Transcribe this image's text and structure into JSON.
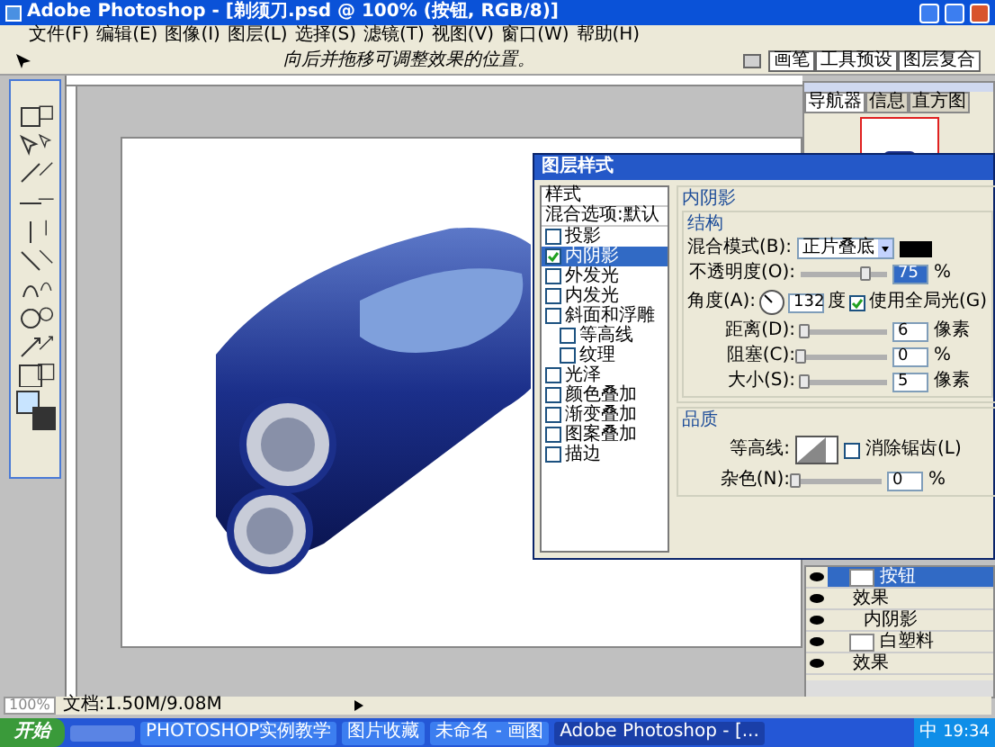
{
  "window": {
    "title": "Adobe Photoshop - [剃须刀.psd @ 100% (按钮, RGB/8)]"
  },
  "menu": [
    "文件(F)",
    "编辑(E)",
    "图像(I)",
    "图层(L)",
    "选择(S)",
    "滤镜(T)",
    "视图(V)",
    "窗口(W)",
    "帮助(H)"
  ],
  "options_bar": {
    "hint": "向后并拖移可调整效果的位置。",
    "palette_tabs": [
      "画笔",
      "工具预设",
      "图层复合"
    ]
  },
  "navigator": {
    "tabs": [
      {
        "label": "导航器",
        "selected": true
      },
      {
        "label": "信息",
        "selected": false
      },
      {
        "label": "直方图",
        "selected": false
      }
    ]
  },
  "layer_style_dialog": {
    "title": "图层样式",
    "styles": [
      {
        "kind": "header",
        "label": "样式",
        "selected": false
      },
      {
        "kind": "header",
        "label": "混合选项:默认",
        "selected": false
      },
      {
        "kind": "check",
        "label": "投影",
        "checked": false,
        "selected": false
      },
      {
        "kind": "check",
        "label": "内阴影",
        "checked": true,
        "selected": true
      },
      {
        "kind": "check",
        "label": "外发光",
        "checked": false,
        "selected": false
      },
      {
        "kind": "check",
        "label": "内发光",
        "checked": false,
        "selected": false
      },
      {
        "kind": "check",
        "label": "斜面和浮雕",
        "checked": false,
        "selected": false,
        "children": [
          {
            "kind": "check",
            "label": "等高线",
            "checked": false,
            "selected": false
          },
          {
            "kind": "check",
            "label": "纹理",
            "checked": false,
            "selected": false
          }
        ]
      },
      {
        "kind": "check",
        "label": "光泽",
        "checked": false,
        "selected": false
      },
      {
        "kind": "check",
        "label": "颜色叠加",
        "checked": false,
        "selected": false
      },
      {
        "kind": "check",
        "label": "渐变叠加",
        "checked": false,
        "selected": false
      },
      {
        "kind": "check",
        "label": "图案叠加",
        "checked": false,
        "selected": false
      },
      {
        "kind": "check",
        "label": "描边",
        "checked": false,
        "selected": false
      }
    ],
    "section_title": "内阴影",
    "structure": {
      "title": "结构",
      "blend_label": "混合模式(B):",
      "blend_mode": "正片叠底",
      "color": "#000000",
      "rows": [
        {
          "kind": "slider",
          "label": "不透明度(O):",
          "value": "75",
          "unit": "%",
          "level": 0.75,
          "highlighted": true
        },
        {
          "kind": "angle",
          "label": "角度(A):",
          "value": "132",
          "unit": "度",
          "check_label": "使用全局光(G)",
          "checked": true
        },
        {
          "kind": "slider",
          "label": "距离(D):",
          "value": "6",
          "unit": "像素",
          "level": 0.05,
          "highlighted": false
        },
        {
          "kind": "slider",
          "label": "阻塞(C):",
          "value": "0",
          "unit": "%",
          "level": 0,
          "highlighted": false
        },
        {
          "kind": "slider",
          "label": "大小(S):",
          "value": "5",
          "unit": "像素",
          "level": 0.05,
          "highlighted": false
        }
      ]
    },
    "quality": {
      "title": "品质",
      "contour_label": "等高线:",
      "anti_alias": {
        "label": "消除锯齿(L)",
        "checked": false
      },
      "noise": {
        "label": "杂色(N):",
        "value": "0",
        "unit": "%",
        "level": 0
      }
    }
  },
  "layers": [
    {
      "kind": "layer",
      "name": "按钮",
      "selected": true
    },
    {
      "kind": "effects",
      "name": "效果"
    },
    {
      "kind": "effect",
      "name": "内阴影"
    },
    {
      "kind": "layer",
      "name": "白塑料",
      "selected": false
    },
    {
      "kind": "effects",
      "name": "效果"
    }
  ],
  "status_bar": {
    "zoom": "100%",
    "doc": "文档:1.50M/9.08M"
  },
  "taskbar": {
    "start": "开始",
    "items": [
      {
        "label": "PHOTOSHOP实例教学",
        "selected": false
      },
      {
        "label": "图片收藏",
        "selected": false
      },
      {
        "label": "未命名 - 画图",
        "selected": false
      },
      {
        "label": "Adobe Photoshop - [...",
        "selected": true
      }
    ],
    "ime": "中",
    "time": "19:34"
  }
}
